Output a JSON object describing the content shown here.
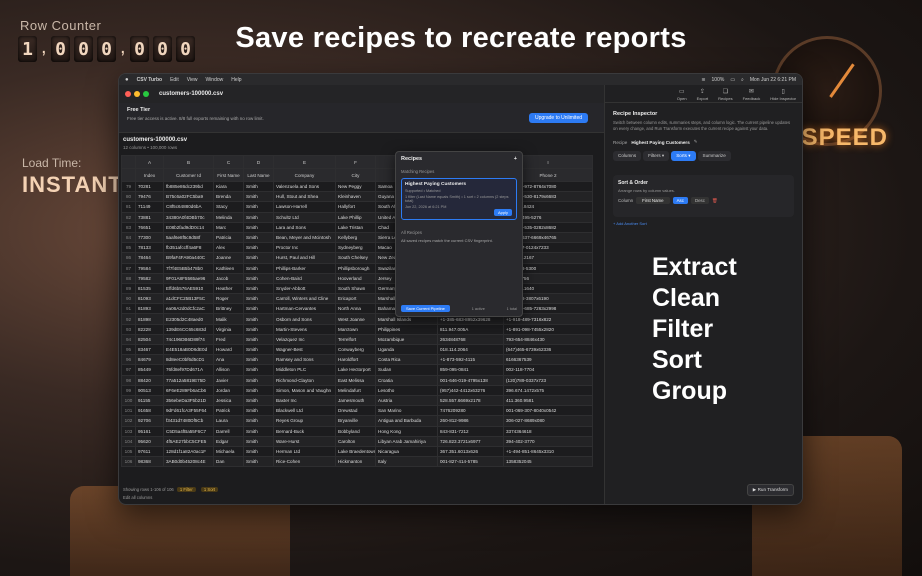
{
  "headline": "Save recipes to recreate reports",
  "features": [
    "Extract",
    "Clean",
    "Filter",
    "Sort",
    "Group"
  ],
  "background": {
    "counter_label": "Row Counter",
    "counter_digits": [
      "1",
      ",",
      "0",
      "0",
      "0",
      ",",
      "0",
      "0",
      "0"
    ],
    "load_label": "Load Time:",
    "instant": "INSTANT",
    "speed": "SPEED"
  },
  "menubar": {
    "app": "CSV Turbo",
    "items": [
      "Edit",
      "View",
      "Window",
      "Help"
    ],
    "battery": "100%",
    "datetime": "Mon Jun 22  6:21 PM"
  },
  "window": {
    "title": "customers-100000.csv"
  },
  "free_tier": {
    "title": "Free Tier",
    "description": "Free tier access is active. 8/8 full exports remaining with no row limit.",
    "upgrade_label": "Upgrade to Unlimited"
  },
  "file": {
    "name": "customers-100000.csv",
    "meta": "12 columns • 100,000 rows"
  },
  "table": {
    "letters": [
      "",
      "A",
      "B",
      "C",
      "D",
      "E",
      "F",
      "G",
      "H",
      "I"
    ],
    "columns": [
      "",
      "Index",
      "Customer Id",
      "First Name",
      "Last Name",
      "Company",
      "City",
      "Country",
      "Phone 1",
      "Phone 2"
    ],
    "rows": [
      [
        "79",
        "70281",
        "fb885e86dc239bd",
        "Kiara",
        "Smith",
        "Valenzuela and Sons",
        "New Peggy",
        "Samoa",
        "",
        "001-333-972-8764x7080"
      ],
      [
        "80",
        "79476",
        "B75c6a02FC5ba9",
        "Brenda",
        "Smith",
        "Hull, Stout and Shea",
        "Kleinhaven",
        "Guyana",
        "",
        "021-512-530-8179x6683"
      ],
      [
        "81",
        "71149",
        "C8f5c64880d6bA",
        "Stacy",
        "Smith",
        "Lawson-Harrell",
        "Hallyfort",
        "South Africa",
        "",
        "278.604.8424"
      ],
      [
        "82",
        "73881",
        "34380A0f4DBb70c",
        "Melinda",
        "Smith",
        "Schultz Ltd",
        "Lake Phillip",
        "United Arab",
        "",
        "+1-359-495-5276"
      ],
      [
        "83",
        "76651",
        "E08b2fad9dD0c14",
        "Marc",
        "Smith",
        "Lara and Sons",
        "Lake Tristan",
        "Chad",
        "",
        "001-580-535-0282x8682"
      ],
      [
        "84",
        "77300",
        "5aaf6e8f5c9d58f",
        "Patricia",
        "Smith",
        "Bean, Meyer and Mcintosh",
        "Kellyberg",
        "Sierra Leone",
        "",
        "+1-683-637-6669x46765"
      ],
      [
        "85",
        "78133",
        "fb351afccff4a6F8",
        "Alex",
        "Smith",
        "Proctor Inc",
        "Sydneyberg",
        "Macao",
        "",
        "(697)847-0124x7233"
      ],
      [
        "86",
        "78464",
        "B9faF4FA90a440C",
        "Joanne",
        "Smith",
        "Hurst, Paul and Hill",
        "South Chelsey",
        "New Zealand",
        "",
        "154.691.2167"
      ],
      [
        "87",
        "79584",
        "7f7f4E5B5b478b0",
        "Kathleen",
        "Smith",
        "Phillips-Barker",
        "Phillipsborough",
        "Swaziland",
        "",
        "(377)828-5300"
      ],
      [
        "88",
        "79582",
        "9F01A8F5565ae96",
        "Jacob",
        "Smith",
        "Cohen-Baird",
        "Hooverland",
        "Jersey",
        "",
        "677560756"
      ],
      [
        "89",
        "81535",
        "Effd6b576AE5910",
        "Heather",
        "Smith",
        "Snyder-Abbott",
        "South Shawn",
        "Germany",
        "",
        "380.553.1640"
      ],
      [
        "90",
        "81093",
        "a1dCFC25B13F5C",
        "Roger",
        "Smith",
        "Carroll, Winters and Cline",
        "Ericaport",
        "Marshall Islands",
        "",
        "(816)148-3807x6190"
      ],
      [
        "91",
        "81893",
        "ea06A2d0dCfc2aC",
        "Brittney",
        "Smith",
        "Hartman-Cervantes",
        "North Anna",
        "Bahamas",
        "",
        "001-890-685-7263x2998"
      ],
      [
        "92",
        "81898",
        "E2305d2C48aed0",
        "Malik",
        "Smith",
        "Osborn and Sons",
        "West Joanne",
        "Marshall Islands",
        "+1-385-683-8952x39628",
        "+1-918-489-7316x822"
      ],
      [
        "93",
        "82228",
        "139dE6CC65c683d",
        "Virginia",
        "Smith",
        "Martin-Stevens",
        "Marctown",
        "Philippines",
        "811.947.005A",
        "+1-891-098-7455x2820"
      ],
      [
        "94",
        "82504",
        "74c196DB6D89f74",
        "Fred",
        "Smith",
        "Velazquez Inc",
        "Terrelfort",
        "Mozambique",
        "2634848768",
        "793-654-8846x430"
      ],
      [
        "95",
        "83467",
        "E4E518aB0D6dE0d",
        "Howard",
        "Smith",
        "Wagner-Best",
        "Conwayberg",
        "Uganda",
        "018.114.2064",
        "(647)465-6739x62336"
      ],
      [
        "96",
        "84679",
        "8d8eeC0bf6d5cD1",
        "Ana",
        "Smith",
        "Ramsey and Sons",
        "Haroldfort",
        "Costa Rica",
        "+1-873-592-4115",
        "6166367539"
      ],
      [
        "97",
        "85449",
        "76fd8ef97Dd671A",
        "Allison",
        "Smith",
        "Middleton PLC",
        "Lake Hectorport",
        "Sudan",
        "859-095-0841",
        "002-118-7704"
      ],
      [
        "98",
        "88420",
        "77a512a5819E75D",
        "Javier",
        "Smith",
        "Richmond-Clayton",
        "East Melissa",
        "Croatia",
        "001-646-019-4795x138",
        "(120)789-0337x723"
      ],
      [
        "99",
        "90513",
        "6F6eE289Fb6aCb6",
        "Jordan",
        "Smith",
        "Simon, Mason and Vaughn",
        "Melindafurt",
        "Lesotho",
        "(957)442-4412x63276",
        "396.674.1472x575"
      ],
      [
        "100",
        "91155",
        "356ebeDa3F5b21D",
        "Jessica",
        "Smith",
        "Baxter Inc",
        "Jamesmouth",
        "Austria",
        "528.557.6669x2178",
        "411.360.9581"
      ],
      [
        "101",
        "91658",
        "9dFd61fcA3F55F64",
        "Patrick",
        "Smith",
        "Blackwell Ltd",
        "Drewstad",
        "San Marino",
        "7476209280",
        "001-069-307-8040x0542"
      ],
      [
        "102",
        "92706",
        "f3431d7480Df5Cb",
        "Laura",
        "Smith",
        "Reyes Group",
        "Bryanville",
        "Antigua and Barbuda",
        "260-812-9986",
        "306-027-8689x080"
      ],
      [
        "103",
        "95161",
        "C5D5a4fBa55F6C7",
        "Darrell",
        "Smith",
        "Bernard-Buck",
        "Bobbyland",
        "Hong Kong",
        "843-831-7212",
        "3374364618"
      ],
      [
        "104",
        "95620",
        "4f5AE27bbC5CFE5",
        "Edgar",
        "Smith",
        "Ware-Hurst",
        "Carolton",
        "Libyan Arab Jamahiriya",
        "726.823.3721x6977",
        "394-402-3770"
      ],
      [
        "105",
        "97611",
        "128d1f1a82A0ac1F",
        "Michaela",
        "Smith",
        "Herman Ltd",
        "Lake Braedentown",
        "Nicaragua",
        "367.351.6013x626",
        "+1-494-851-8645x3310"
      ],
      [
        "106",
        "98368",
        "3AB0d0b45208c4E",
        "Dan",
        "Smith",
        "Rice-Cohen",
        "Hickmanton",
        "Italy",
        "001-827-414-5785",
        "1358352045"
      ]
    ]
  },
  "status": {
    "showing": "Showing rows 1-106 of 106",
    "filter_badge": "1 Filter",
    "sort_badge": "1 Sort",
    "note": "Edit all columns"
  },
  "popover": {
    "title": "Recipes",
    "matching_label": "Matching Recipes",
    "card_title": "Highest Paying Customers",
    "card_subtitle": "Supported • Matched",
    "card_detail": "1 filter (Last Name equals Smith) • 1 sort • 2 columns (2 steps total)",
    "card_date": "Jun 22, 2026 at 6:21 PM",
    "apply_label": "Apply",
    "all_label": "All Recipes",
    "all_note": "All saved recipes match the current CSV fingerprint.",
    "save_label": "Save Current Pipeline",
    "count_left": "1 active",
    "count_right": "1 total"
  },
  "toolbar": {
    "items": [
      {
        "label": "Open",
        "icon": "folder-icon",
        "glyph": "▭"
      },
      {
        "label": "Export",
        "icon": "export-icon",
        "glyph": "⇪"
      },
      {
        "label": "Recipes",
        "icon": "bookmark-icon",
        "glyph": "❏"
      },
      {
        "label": "Feedback",
        "icon": "feedback-icon",
        "glyph": "✉"
      },
      {
        "label": "Hide Inspector",
        "icon": "sidebar-icon",
        "glyph": "▯"
      }
    ]
  },
  "inspector": {
    "title": "Recipe Inspector",
    "description": "Switch between column edits, summaries steps, and column logic. The current pipeline updates on every change, and Run Transform executes the current recipe against your data.",
    "recipe_label": "Recipe",
    "recipe_name": "Highest Paying Customers",
    "tabs": [
      "Columns",
      "Filters ▾",
      "Sorts ▾",
      "Summarize"
    ],
    "active_tab": 2,
    "sort_title": "Sort & Order",
    "sort_subtitle": "Arrange rows by column values.",
    "column_label": "Column",
    "column_value": "First Name",
    "asc_label": "Asc",
    "desc_label": "Desc",
    "add_sort": "+ Add Another Sort",
    "run_label": "▶ Run Transform"
  }
}
